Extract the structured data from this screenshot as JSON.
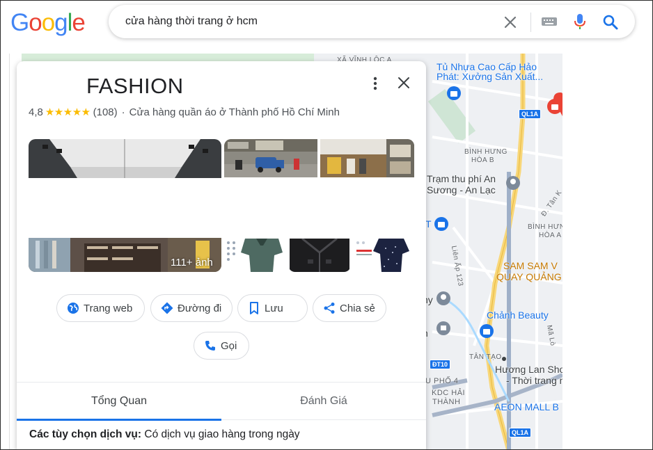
{
  "search": {
    "logo_letters": [
      "G",
      "o",
      "o",
      "g",
      "l",
      "e"
    ],
    "query": "cửa hàng thời trang ở hcm",
    "icons": [
      "close-icon",
      "keyboard-icon",
      "microphone-icon",
      "search-icon"
    ]
  },
  "map": {
    "labels": {
      "xa_vinh_loc": "XÃ VĨNH LỘC A",
      "tu_nhua_1": "Tủ Nhựa Cao Cấp Hảo",
      "tu_nhua_2": "Phát: Xưởng Sản Xuất...",
      "binh_hung_1": "BÌNH HƯNG",
      "binh_hung_2": "HÒA B",
      "tram_thu_phi_1": "Trạm thu phí An",
      "tram_thu_phi_2": "Sương - An Lạc",
      "tan_ky": "Đ. Tân K",
      "binh_hung_hoa_a_1": "BÌNH HƯNG",
      "binh_hung_hoa_a_2": "HÒA A",
      "lien_ap": "Liên Ấp 123",
      "sam_sam_1": "SAM SAM V",
      "sam_sam_2": "QUAY QUẢNG",
      "chanh_beauty": "Chảnh Beauty",
      "ma_lo": "Mã Lò",
      "tan_tao": "TÂN TẠO",
      "huong_lan_1": "Hương Lan Sho",
      "huong_lan_2": "- Thời trang n",
      "phuong_4": "U PHỐ 4",
      "kdc_1": "KDC HẢI",
      "kdc_2": "THÀNH",
      "aeon": "AEON MALL B",
      "ql1a_top": "QL1A",
      "ql1a_bottom": "QL1A",
      "dt10": "ĐT10",
      "t_left": "T",
      "ny": "ny",
      "n": "n"
    }
  },
  "place": {
    "name": "FASHION",
    "rating": "4,8",
    "stars": "★★★★★",
    "review_count": "(108)",
    "separator": "·",
    "category": "Cửa hàng quần áo ở Thành phố Hồ Chí Minh",
    "photo_count": "111+ ảnh",
    "actions": {
      "website": "Trang web",
      "directions": "Đường đi",
      "save": "Lưu",
      "share": "Chia sẻ",
      "call": "Gọi"
    },
    "tabs": {
      "overview": "Tổng Quan",
      "reviews": "Đánh Giá"
    },
    "service_options_label": "Các tùy chọn dịch vụ:",
    "service_options_value": "Có dịch vụ giao hàng trong ngày",
    "colors": {
      "accent": "#1a73e8",
      "star": "#fbbc04"
    }
  }
}
